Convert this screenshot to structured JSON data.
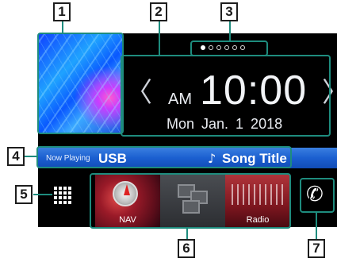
{
  "pagination": {
    "pages": 6,
    "active": 0
  },
  "clock": {
    "ampm": "AM",
    "time": "10:00",
    "date": "Mon Jan.  1  2018"
  },
  "nav_arrows": {
    "left": "〈",
    "right": "〉"
  },
  "now_playing": {
    "label": "Now Playing",
    "source": "USB",
    "note": "♪",
    "title": "Song Title"
  },
  "tiles": [
    {
      "label": "NAV",
      "icon": "compass-icon"
    },
    {
      "label": "",
      "icon": "windows-icon"
    },
    {
      "label": "Radio",
      "icon": "radio-dial-icon"
    }
  ],
  "phone": {
    "glyph": "✆",
    "icon": "phone-icon"
  },
  "apps": {
    "icon": "grid-icon"
  },
  "callouts": [
    "1",
    "2",
    "3",
    "4",
    "5",
    "6",
    "7"
  ],
  "colors": {
    "callout_outline": "#1e8c7e",
    "now_playing_bar": "#1b5fd0",
    "screen_bg": "#000000"
  }
}
